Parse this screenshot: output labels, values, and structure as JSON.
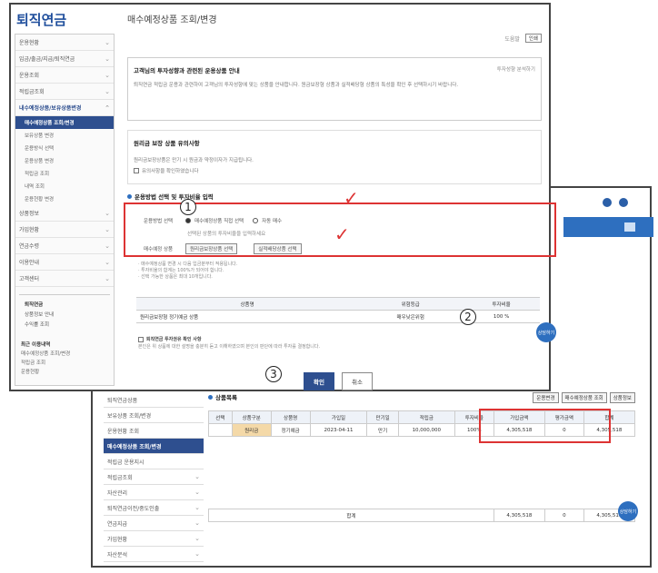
{
  "logo": "퇴직연금",
  "page_title": "매수예정상품 조회/변경",
  "toolbar": {
    "print": "인쇄",
    "help": "도움말"
  },
  "sidebar": {
    "items": [
      "운용현황",
      "입금/출금/지급/퇴직연금",
      "운용조회",
      "적립금조회"
    ],
    "active_section": "내수예정상품/보유상품변경",
    "subs": [
      "매수예정상품 조회/변경",
      "보유상품 변경",
      "운용방식 선택",
      "운용상품 변경",
      "적립금 조회",
      "내역 조회",
      "운용현황 변경"
    ],
    "active_sub": "매수예정상품 조회/변경",
    "items2": [
      "상품정보",
      "가입현황",
      "연금수령",
      "이용안내",
      "고객센터"
    ],
    "box_title": "퇴직연금",
    "box_items": [
      "상품정보 안내",
      "수익률 조회"
    ],
    "footer_title": "최근 이용내역",
    "footer_items": [
      "매수예정상품 조회/변경",
      "적립금 조회",
      "운용현황"
    ]
  },
  "box1": {
    "title": "고객님의 투자성향과 관련된 운용상품 안내",
    "right": "투자성향 분석하기",
    "text": "퇴직연금 적립금 운용과 관련하여 고객님의 투자성향에 맞는 상품을 안내합니다. 원금보장형 상품과 실적배당형 상품의 특성을 확인 후 선택하시기 바랍니다."
  },
  "box2": {
    "title": "원리금 보장 상품 유의사항",
    "text": "원리금보장상품은 만기 시 원금과 약정이자가 지급됩니다.",
    "checkbox": "유의사항을 확인하였습니다"
  },
  "section3": "운용방법 선택 및 투자비율 입력",
  "form": {
    "label1": "운용방법 선택",
    "opt1": "매수예정상품 직접 선택",
    "opt2": "자동 매수",
    "label_detail": "선택된 상품의 투자비율을 입력하세요",
    "label2": "매수예정 상품",
    "btn1": "원리금보장상품 선택",
    "btn2": "실적배당상품 선택"
  },
  "notes": [
    "· 매수예정상품 변경 시 다음 입금분부터 적용됩니다.",
    "· 투자비율의 합계는 100%가 되어야 합니다.",
    "· 선택 가능한 상품은 최대 10개입니다."
  ],
  "select_table": {
    "headers": [
      "상품명",
      "위험등급",
      "투자비율"
    ],
    "row": [
      "원리금보장형 정기예금 상품",
      "매우낮은위험",
      "100 %"
    ]
  },
  "agree": {
    "title": "퇴직연금 투자권유 확인 사항",
    "text": "본인은 위 상품에 대한 설명을 충분히 듣고 이해하였으며 본인의 판단에 따라 투자를 결정합니다."
  },
  "buttons": {
    "confirm": "확인",
    "cancel": "취소"
  },
  "markers": [
    "1",
    "2",
    "3"
  ],
  "fab": "상담하기",
  "back": {
    "sidebar": [
      "퇴직연금상품",
      "보유상품 조회/변경",
      "운용현황 조회",
      "매수예정상품 조회/변경",
      "적립금 운용지시",
      "적립금조회",
      "자산관리",
      "퇴직연금이전/중도인출",
      "연금지급",
      "가입현황",
      "자산분석"
    ],
    "active": "매수예정상품 조회/변경",
    "section": "상품목록",
    "btns": [
      "운용변경",
      "매수예정상품 조회",
      "상품정보"
    ],
    "headers": [
      "선택",
      "상품구분",
      "상품명",
      "가입일",
      "만기일",
      "적립금",
      "투자비율",
      "가입금액",
      "평가금액",
      "합계"
    ],
    "row": [
      "",
      "원리금",
      "정기예금",
      "2023-04-11",
      "만기",
      "10,000,000",
      "100%",
      "4,305,518",
      "0",
      "4,305,518"
    ],
    "total_label": "합계",
    "total": [
      "4,305,518",
      "0",
      "4,305,518"
    ],
    "highlight_title": "평가금액"
  }
}
